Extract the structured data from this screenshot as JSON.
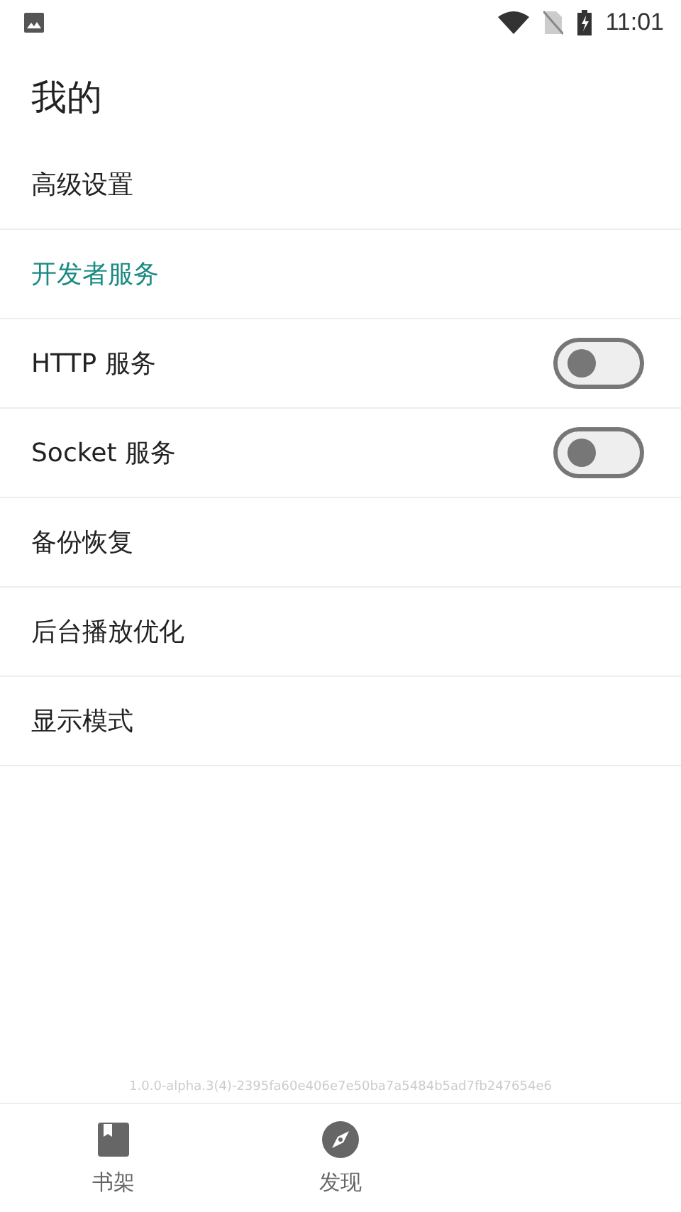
{
  "status_bar": {
    "time": "11:01"
  },
  "page": {
    "title": "我的"
  },
  "items": [
    {
      "kind": "link",
      "label": "高级设置"
    },
    {
      "kind": "section",
      "label": "开发者服务"
    },
    {
      "kind": "switch",
      "label": "HTTP 服务",
      "on": false
    },
    {
      "kind": "switch",
      "label": "Socket 服务",
      "on": false
    },
    {
      "kind": "link",
      "label": "备份恢复"
    },
    {
      "kind": "link",
      "label": "后台播放优化"
    },
    {
      "kind": "link",
      "label": "显示模式"
    }
  ],
  "version": "1.0.0-alpha.3(4)-2395fa60e406e7e50ba7a5484b5ad7fb247654e6",
  "bottom_nav": [
    {
      "kind": "book",
      "label": "书架",
      "selected": false
    },
    {
      "kind": "compass",
      "label": "发现",
      "selected": false
    }
  ]
}
